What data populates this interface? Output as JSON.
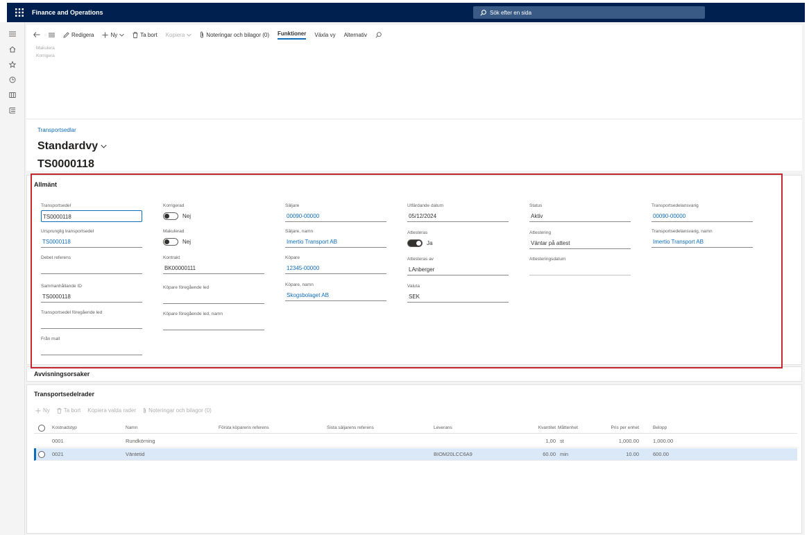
{
  "app": {
    "title": "Finance and Operations",
    "search_placeholder": "Sök efter en sida"
  },
  "actions": {
    "edit": "Redigera",
    "new": "Ny",
    "delete": "Ta bort",
    "copy": "Kopiera",
    "notes": "Noteringar och bilagor (0)",
    "functions": "Funktioner",
    "switch_view": "Växla vy",
    "options": "Alternativ",
    "sub_items": [
      "Makulera",
      "Korrigera"
    ]
  },
  "header": {
    "breadcrumb": "Transportsedlar",
    "view": "Standardvy",
    "record": "TS0000118"
  },
  "general": {
    "title": "Allmänt",
    "col1": {
      "transportsedel": {
        "label": "Transportsedel",
        "value": "TS0000118"
      },
      "ursprunglig": {
        "label": "Ursprunglig transportsedel",
        "value": "TS0000118"
      },
      "debet": {
        "label": "Debet referens",
        "value": ""
      },
      "sammanhallande": {
        "label": "Sammanhållande ID",
        "value": "TS0000118"
      },
      "foregaende": {
        "label": "Transportsedel föregående led",
        "value": ""
      },
      "fran_mall": {
        "label": "Från mall",
        "value": ""
      }
    },
    "col2": {
      "korrigerad": {
        "label": "Korrigerad",
        "value": "Nej"
      },
      "makulerad": {
        "label": "Makulerad",
        "value": "Nej"
      },
      "kontrakt": {
        "label": "Kontrakt",
        "value": "BK00000111"
      },
      "kopare_led": {
        "label": "Köpare föregående led",
        "value": ""
      },
      "kopare_led_namn": {
        "label": "Köpare föregående led, namn",
        "value": ""
      }
    },
    "col3": {
      "saljare": {
        "label": "Säljare",
        "value": "00090-00000"
      },
      "saljare_namn": {
        "label": "Säljare, namn",
        "value": "Imertio Transport AB"
      },
      "kopare": {
        "label": "Köpare",
        "value": "12345-00000"
      },
      "kopare_namn": {
        "label": "Köpare, namn",
        "value": "Skogsbolaget AB"
      }
    },
    "col4": {
      "utfardande": {
        "label": "Utfärdande datum",
        "value": "05/12/2024"
      },
      "attestbar": {
        "label": "Attesteras",
        "value": "Ja"
      },
      "attesteras_av": {
        "label": "Attesteras av",
        "value": "LAnberger"
      },
      "valuta": {
        "label": "Valuta",
        "value": "SEK"
      }
    },
    "col5": {
      "status": {
        "label": "Status",
        "value": "Aktiv"
      },
      "attestering": {
        "label": "Attestering",
        "value": "Väntar på attest"
      },
      "attesteringsdatum": {
        "label": "Attesteringsdatum",
        "value": ""
      }
    },
    "col6": {
      "ansvarig": {
        "label": "Transportsedelansvarig",
        "value": "00090-00000"
      },
      "ansvarig_namn": {
        "label": "Transportsedelansvarig, namn",
        "value": "Imertio Transport AB"
      }
    }
  },
  "rejection": {
    "title": "Avvisningsorsaker"
  },
  "lines": {
    "title": "Transportsedelrader",
    "toolbar": {
      "new": "Ny",
      "delete": "Ta bort",
      "copy_selected": "Kopiera valda rader",
      "notes": "Noteringar och bilagor (0)"
    },
    "columns": [
      "Kostnadstyp",
      "Namn",
      "Första köparens referens",
      "Sista säljarens referens",
      "Leverans",
      "Kvantitet",
      "Måttenhet",
      "Pris per enhet",
      "Belopp"
    ],
    "rows": [
      {
        "kostnadstyp": "0001",
        "namn": "Rundkörning",
        "forsta": "",
        "sista": "",
        "leverans": "",
        "kvantitet": "1,00",
        "enhet": "st",
        "pris": "1,000.00",
        "belopp": "1,000.00",
        "selected": false
      },
      {
        "kostnadstyp": "0021",
        "namn": "Väntetid",
        "forsta": "",
        "sista": "",
        "leverans": "BIOM20LCC6A9",
        "kvantitet": "60.00",
        "enhet": "min",
        "pris": "10.00",
        "belopp": "600.00",
        "selected": true
      }
    ]
  },
  "colors": {
    "topbar": "#002050",
    "accent": "#0f6cbd",
    "highlight": "#c4262e",
    "selected_row": "#dbe8f8"
  }
}
